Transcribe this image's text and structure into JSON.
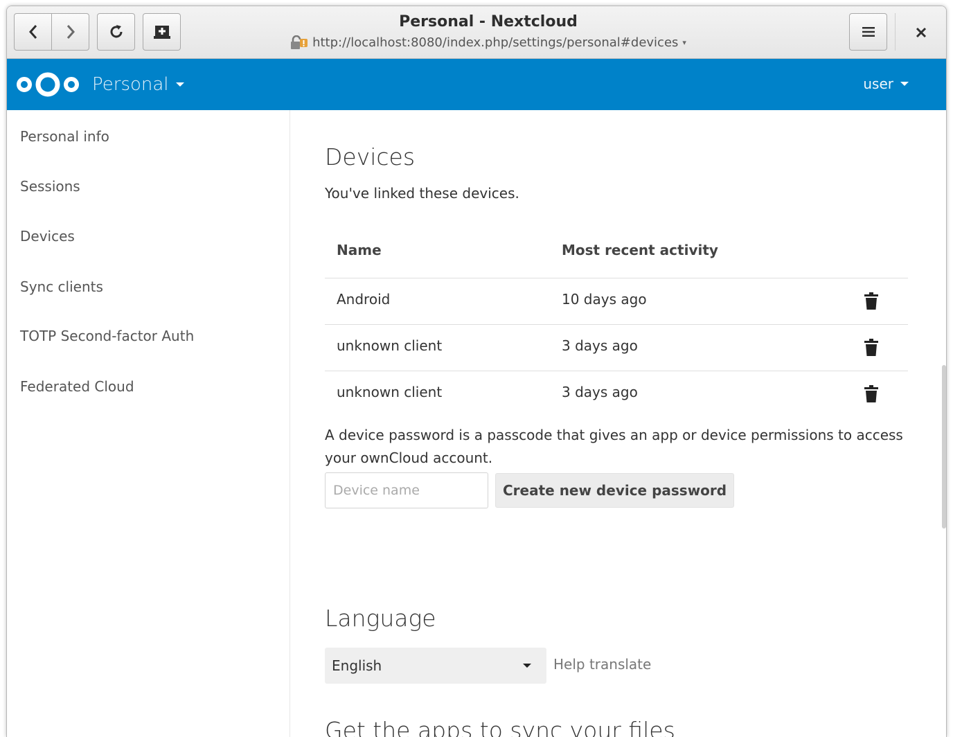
{
  "window": {
    "title": "Personal - Nextcloud",
    "url": "http://localhost:8080/index.php/settings/personal#devices"
  },
  "header": {
    "app_name": "Personal",
    "user": "user",
    "brand_color": "#0082c9"
  },
  "sidebar": {
    "items": [
      {
        "label": "Personal info"
      },
      {
        "label": "Sessions"
      },
      {
        "label": "Devices"
      },
      {
        "label": "Sync clients"
      },
      {
        "label": "TOTP Second-factor Auth"
      },
      {
        "label": "Federated Cloud"
      }
    ]
  },
  "devices": {
    "title": "Devices",
    "intro": "You've linked these devices.",
    "columns": [
      "Name",
      "Most recent activity"
    ],
    "rows": [
      {
        "name": "Android",
        "activity": "10 days ago"
      },
      {
        "name": "unknown client",
        "activity": "3 days ago"
      },
      {
        "name": "unknown client",
        "activity": "3 days ago"
      }
    ],
    "description_line1": "A device password is a passcode that gives an app or device permissions to access",
    "description_line2": "your ownCloud account.",
    "input_placeholder": "Device name",
    "create_button": "Create new device password"
  },
  "language": {
    "title": "Language",
    "selected": "English",
    "help_link": "Help translate"
  },
  "sync": {
    "title": "Get the apps to sync your files"
  },
  "icons": {
    "back": "chevron-left-icon",
    "forward": "chevron-right-icon",
    "reload": "reload-icon",
    "bookmark": "bookmark-add-icon",
    "menu": "hamburger-icon",
    "close": "close-icon",
    "insecure": "insecure-lock-icon",
    "delete": "trash-icon"
  }
}
